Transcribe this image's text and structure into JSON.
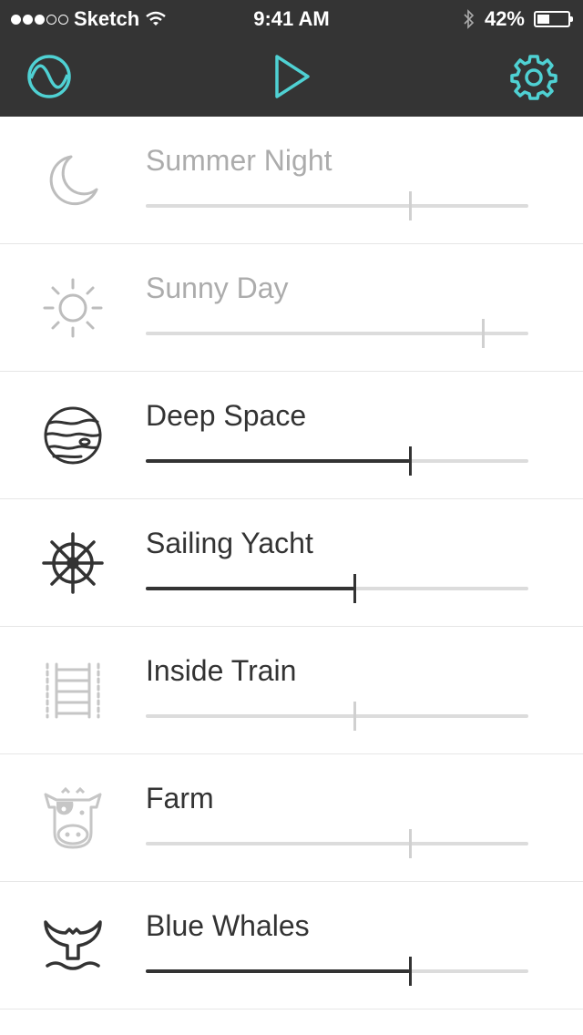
{
  "status_bar": {
    "carrier": "Sketch",
    "time": "9:41 AM",
    "battery_text": "42%",
    "battery_level": 0.42,
    "signal_bars": 3
  },
  "toolbar": {
    "left_icon": "wave-icon",
    "center_icon": "play-icon",
    "right_icon": "gear-icon",
    "accent_color": "#4fd1d3"
  },
  "sounds": [
    {
      "title": "Summer Night",
      "icon": "moon-icon",
      "active": false,
      "level": 0.69
    },
    {
      "title": "Sunny Day",
      "icon": "sun-icon",
      "active": false,
      "level": 0.88
    },
    {
      "title": "Deep Space",
      "icon": "planet-icon",
      "active": true,
      "level": 0.69
    },
    {
      "title": "Sailing Yacht",
      "icon": "ship-wheel-icon",
      "active": true,
      "level": 0.545
    },
    {
      "title": "Inside Train",
      "icon": "train-tracks-icon",
      "active": false,
      "level": 0.545
    },
    {
      "title": "Farm",
      "icon": "cow-icon",
      "active": false,
      "level": 0.69
    },
    {
      "title": "Blue Whales",
      "icon": "whale-tail-icon",
      "active": true,
      "level": 0.69
    }
  ]
}
